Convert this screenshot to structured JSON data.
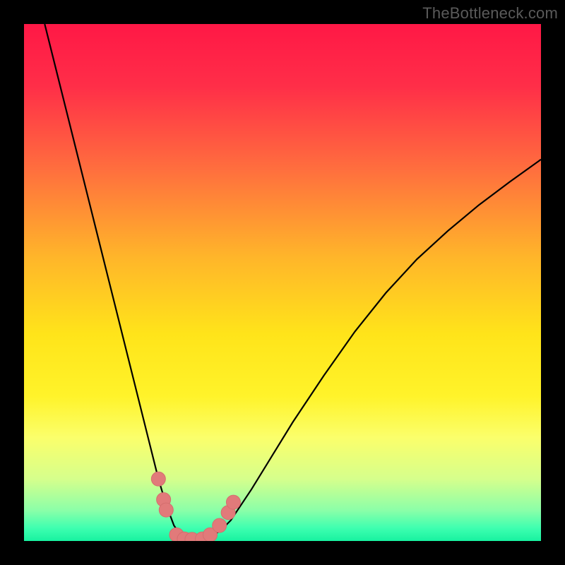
{
  "watermark": "TheBottleneck.com",
  "chart_data": {
    "type": "line",
    "title": "",
    "xlabel": "",
    "ylabel": "",
    "xlim": [
      0,
      100
    ],
    "ylim": [
      0,
      100
    ],
    "grid": false,
    "gradient_stops": [
      {
        "offset": 0.0,
        "color": "#ff1846"
      },
      {
        "offset": 0.12,
        "color": "#ff2e48"
      },
      {
        "offset": 0.28,
        "color": "#ff6e3e"
      },
      {
        "offset": 0.45,
        "color": "#ffb52a"
      },
      {
        "offset": 0.6,
        "color": "#ffe41a"
      },
      {
        "offset": 0.72,
        "color": "#fff32a"
      },
      {
        "offset": 0.8,
        "color": "#fbff6b"
      },
      {
        "offset": 0.88,
        "color": "#d6ff8c"
      },
      {
        "offset": 0.94,
        "color": "#8cffa8"
      },
      {
        "offset": 0.975,
        "color": "#3effb0"
      },
      {
        "offset": 1.0,
        "color": "#18f2a0"
      }
    ],
    "series": [
      {
        "name": "bottleneck-curve",
        "stroke": "#000000",
        "stroke_width": 2.2,
        "x": [
          4,
          6,
          8,
          10,
          12,
          14,
          16,
          18,
          20,
          22,
          24,
          26,
          27.5,
          29,
          30.5,
          32,
          34,
          36,
          38,
          40,
          44,
          48,
          52,
          58,
          64,
          70,
          76,
          82,
          88,
          94,
          100
        ],
        "values": [
          100,
          92,
          84,
          76,
          68,
          60,
          52,
          44,
          36,
          28,
          20,
          12,
          7,
          3,
          0.8,
          0.2,
          0.2,
          0.8,
          2,
          4,
          10,
          16.5,
          23,
          32,
          40.5,
          48,
          54.5,
          60,
          65,
          69.5,
          73.8
        ]
      }
    ],
    "markers": {
      "name": "bottom-markers",
      "color": "#e17a7a",
      "stroke": "#d46e6e",
      "radius": 10,
      "points": [
        {
          "x": 26.0,
          "y": 12.0
        },
        {
          "x": 27.0,
          "y": 8.0
        },
        {
          "x": 27.5,
          "y": 6.0
        },
        {
          "x": 29.5,
          "y": 1.2
        },
        {
          "x": 31.0,
          "y": 0.4
        },
        {
          "x": 32.5,
          "y": 0.3
        },
        {
          "x": 34.5,
          "y": 0.4
        },
        {
          "x": 36.0,
          "y": 1.2
        },
        {
          "x": 37.8,
          "y": 3.0
        },
        {
          "x": 39.5,
          "y": 5.5
        },
        {
          "x": 40.5,
          "y": 7.5
        }
      ]
    }
  }
}
